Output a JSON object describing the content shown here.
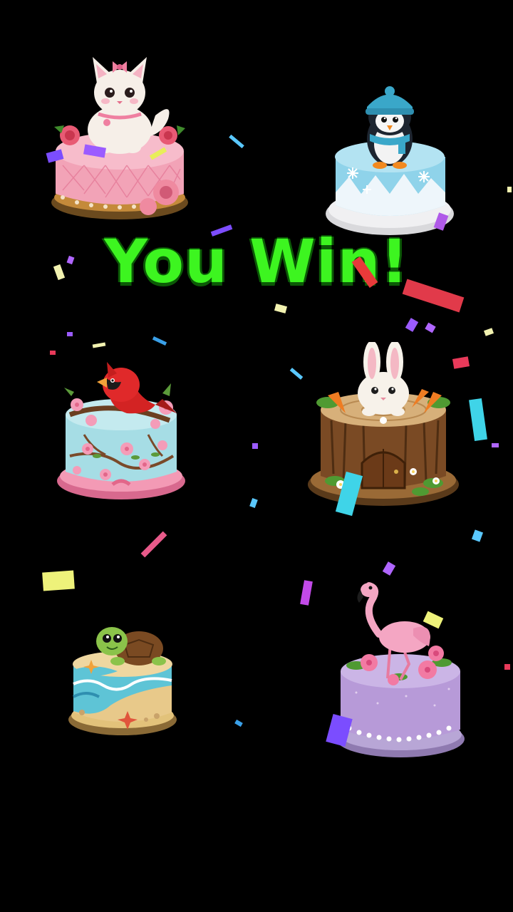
{
  "title": "You Win!",
  "cakes": [
    {
      "topper": "kitten",
      "cake_color": "#f2a3b7"
    },
    {
      "topper": "penguin",
      "cake_color": "#8fd3ea"
    },
    {
      "topper": "cardinal",
      "cake_color": "#a6dde5"
    },
    {
      "topper": "bunny",
      "cake_color": "#7a4a24"
    },
    {
      "topper": "turtle",
      "cake_color": "#5ec4d6"
    },
    {
      "topper": "flamingo",
      "cake_color": "#b79ad8"
    }
  ],
  "colors": {
    "background": "#000000",
    "title": "#3df520",
    "title_outline": "#0b5a06"
  }
}
